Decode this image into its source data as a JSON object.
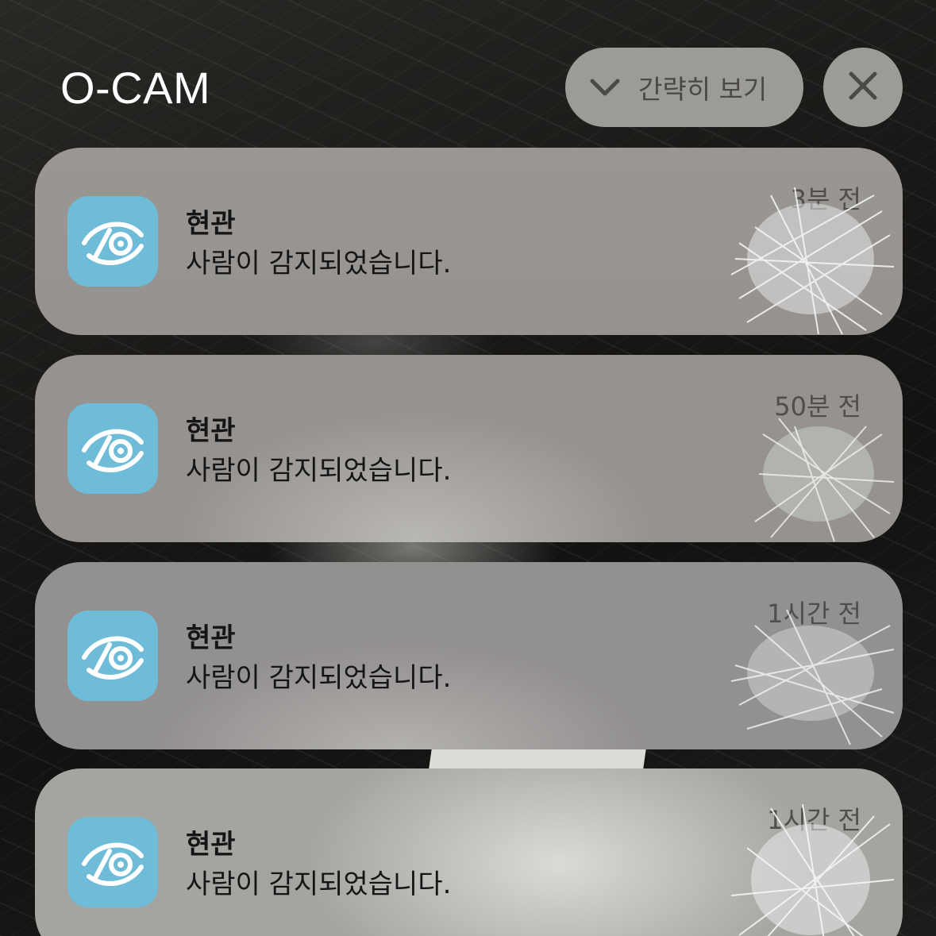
{
  "group": {
    "title": "O-CAM",
    "collapse_label": "간략히 보기",
    "collapse_icon": "chevron-down-icon",
    "close_icon": "close-icon"
  },
  "notifications": [
    {
      "title": "현관",
      "body": "사람이 감지되었습니다.",
      "time": "3분 전"
    },
    {
      "title": "현관",
      "body": "사람이 감지되었습니다.",
      "time": "50분 전"
    },
    {
      "title": "현관",
      "body": "사람이 감지되었습니다.",
      "time": "1시간 전"
    },
    {
      "title": "현관",
      "body": "사람이 감지되었습니다.",
      "time": "1시간 전"
    }
  ],
  "colors": {
    "app_icon_background": "#6fbcd8",
    "notification_background": "#9a9793",
    "pill_background": "#a8a6a2",
    "text_primary": "#151515",
    "text_secondary": "#4f4e4c"
  }
}
